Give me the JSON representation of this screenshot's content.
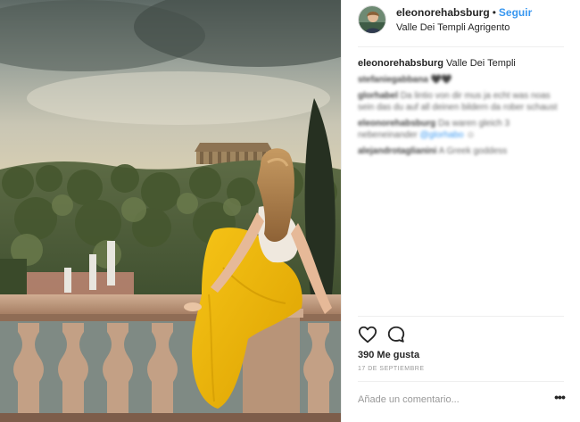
{
  "post": {
    "username": "eleonorehabsburg",
    "separator": "•",
    "follow_label": "Seguir",
    "location": "Valle Dei Templi Agrigento",
    "avatar_icon": "profile-avatar"
  },
  "caption": {
    "username": "eleonorehabsburg",
    "text": "Valle Dei Templi"
  },
  "comments": [
    {
      "user": "stefaniegabbana",
      "text": "",
      "emoji": "🖤🖤"
    },
    {
      "user": "glorhabel",
      "text": "Da lintio von dir mus ja echt was noas sein das du auf all deinen bildern da rober schaust"
    },
    {
      "user": "eleonorehabsburg",
      "text": "Da waren gleich 3 nebeneinander",
      "mention": "@glorhabo",
      "tail": "☺"
    },
    {
      "user": "alejandrotaglianini",
      "text": "A Greek goddess"
    }
  ],
  "actions": {
    "like_icon": "heart-icon",
    "comment_icon": "comment-icon",
    "likes_text": "390 Me gusta",
    "date_text": "17 DE SEPTIEMBRE"
  },
  "composer": {
    "placeholder": "Añade un comentario...",
    "more_icon": "more-options-icon",
    "more_label": "•••"
  },
  "colors": {
    "link_blue": "#3897f0",
    "text_primary": "#262626",
    "text_secondary": "#999999",
    "divider": "#efefef",
    "dress_yellow": "#f2b500"
  }
}
